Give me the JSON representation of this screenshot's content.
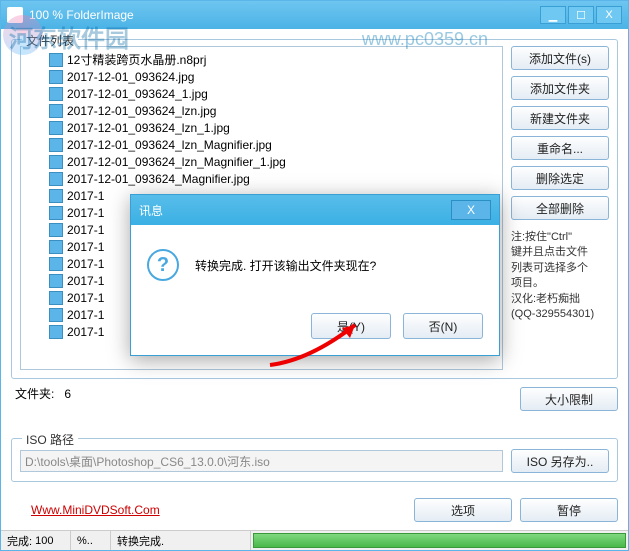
{
  "window": {
    "title": "100 %   FolderImage",
    "min": "▁",
    "max": "☐",
    "close": "X"
  },
  "watermark": {
    "text": "河东软件园",
    "url": "www.pc0359.cn"
  },
  "filelist": {
    "group_label": "文件列表",
    "items": [
      "12寸精装跨页水晶册.n8prj",
      "2017-12-01_093624.jpg",
      "2017-12-01_093624_1.jpg",
      "2017-12-01_093624_lzn.jpg",
      "2017-12-01_093624_lzn_1.jpg",
      "2017-12-01_093624_lzn_Magnifier.jpg",
      "2017-12-01_093624_lzn_Magnifier_1.jpg",
      "2017-12-01_093624_Magnifier.jpg",
      "2017-1",
      "2017-1",
      "2017-1",
      "2017-1",
      "2017-1",
      "2017-1",
      "2017-1",
      "2017-1",
      "2017-1"
    ]
  },
  "buttons": {
    "add_files": "添加文件(s)",
    "add_folder": "添加文件夹",
    "new_folder": "新建文件夹",
    "rename": "重命名...",
    "delete_sel": "删除选定",
    "delete_all": "全部删除",
    "size_limit": "大小限制",
    "iso_saveas": "ISO 另存为..",
    "options": "选项",
    "pause": "暂停"
  },
  "hint": {
    "l1": "注:按住\"Ctrl\"",
    "l2": "键并且点击文件",
    "l3": "列表可选择多个",
    "l4": "项目。",
    "l5": "汉化:老朽痴拙",
    "l6": "(QQ-329554301)"
  },
  "folder_count": {
    "label": "文件夹:",
    "value": "6"
  },
  "iso": {
    "group_label": "ISO 路径",
    "path": "D:\\tools\\桌面\\Photoshop_CS6_13.0.0\\河东.iso"
  },
  "link": "Www.MiniDVDSoft.Com",
  "status": {
    "done_label": "完成:",
    "done_val": "100",
    "unit": "%..",
    "msg": "转换完成."
  },
  "dialog": {
    "title": "讯息",
    "message": "转换完成. 打开该输出文件夹现在?",
    "yes": "是(Y)",
    "no": "否(N)",
    "close": "X"
  }
}
